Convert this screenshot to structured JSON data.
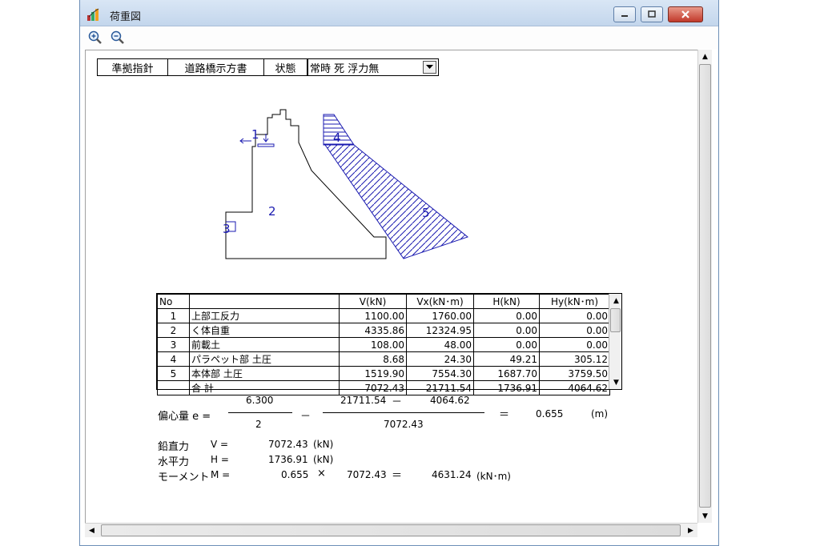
{
  "window": {
    "title": "荷重図"
  },
  "params": {
    "standard_label": "準拠指針",
    "standard_value": "道路橋示方書",
    "state_label": "状態",
    "state_value": "常時 死 浮力無"
  },
  "diagram": {
    "labels": [
      "1",
      "2",
      "3",
      "4",
      "5"
    ]
  },
  "table": {
    "headers": [
      "No",
      "",
      "V(kN)",
      "Vx(kN･m)",
      "H(kN)",
      "Hy(kN･m)"
    ],
    "rows": [
      {
        "no": "1",
        "name": "上部工反力",
        "v": "1100.00",
        "vx": "1760.00",
        "h": "0.00",
        "hy": "0.00"
      },
      {
        "no": "2",
        "name": "く体自重",
        "v": "4335.86",
        "vx": "12324.95",
        "h": "0.00",
        "hy": "0.00"
      },
      {
        "no": "3",
        "name": "前載土",
        "v": "108.00",
        "vx": "48.00",
        "h": "0.00",
        "hy": "0.00"
      },
      {
        "no": "4",
        "name": "パラペット部 土圧",
        "v": "8.68",
        "vx": "24.30",
        "h": "49.21",
        "hy": "305.12"
      },
      {
        "no": "5",
        "name": "本体部 土圧",
        "v": "1519.90",
        "vx": "7554.30",
        "h": "1687.70",
        "hy": "3759.50"
      },
      {
        "no": "",
        "name": "合 計",
        "v": "7072.43",
        "vx": "21711.54",
        "h": "1736.91",
        "hy": "4064.62"
      }
    ]
  },
  "eccentricity": {
    "label": "偏心量 e =",
    "width": "6.300",
    "divisor": "2",
    "minus": "－",
    "vx_sum": "21711.54",
    "hy_sum": "4064.62",
    "v_sum": "7072.43",
    "equals": "＝",
    "result": "0.655",
    "unit": "(m)"
  },
  "summary": {
    "vertical_label": "鉛直力",
    "vertical_symbol": "V =",
    "vertical_value": "7072.43",
    "vertical_unit": "(kN)",
    "horizontal_label": "水平力",
    "horizontal_symbol": "H =",
    "horizontal_value": "1736.91",
    "horizontal_unit": "(kN)",
    "moment_label": "モーメント",
    "moment_symbol": "M =",
    "moment_e": "0.655",
    "times": "×",
    "moment_v": "7072.43",
    "moment_equals": "＝",
    "moment_value": "4631.24",
    "moment_unit": "(kN･m)"
  },
  "colors": {
    "hatch": "#1a1ab0",
    "outline": "#000000",
    "titlebar": "#c8d9ee"
  }
}
